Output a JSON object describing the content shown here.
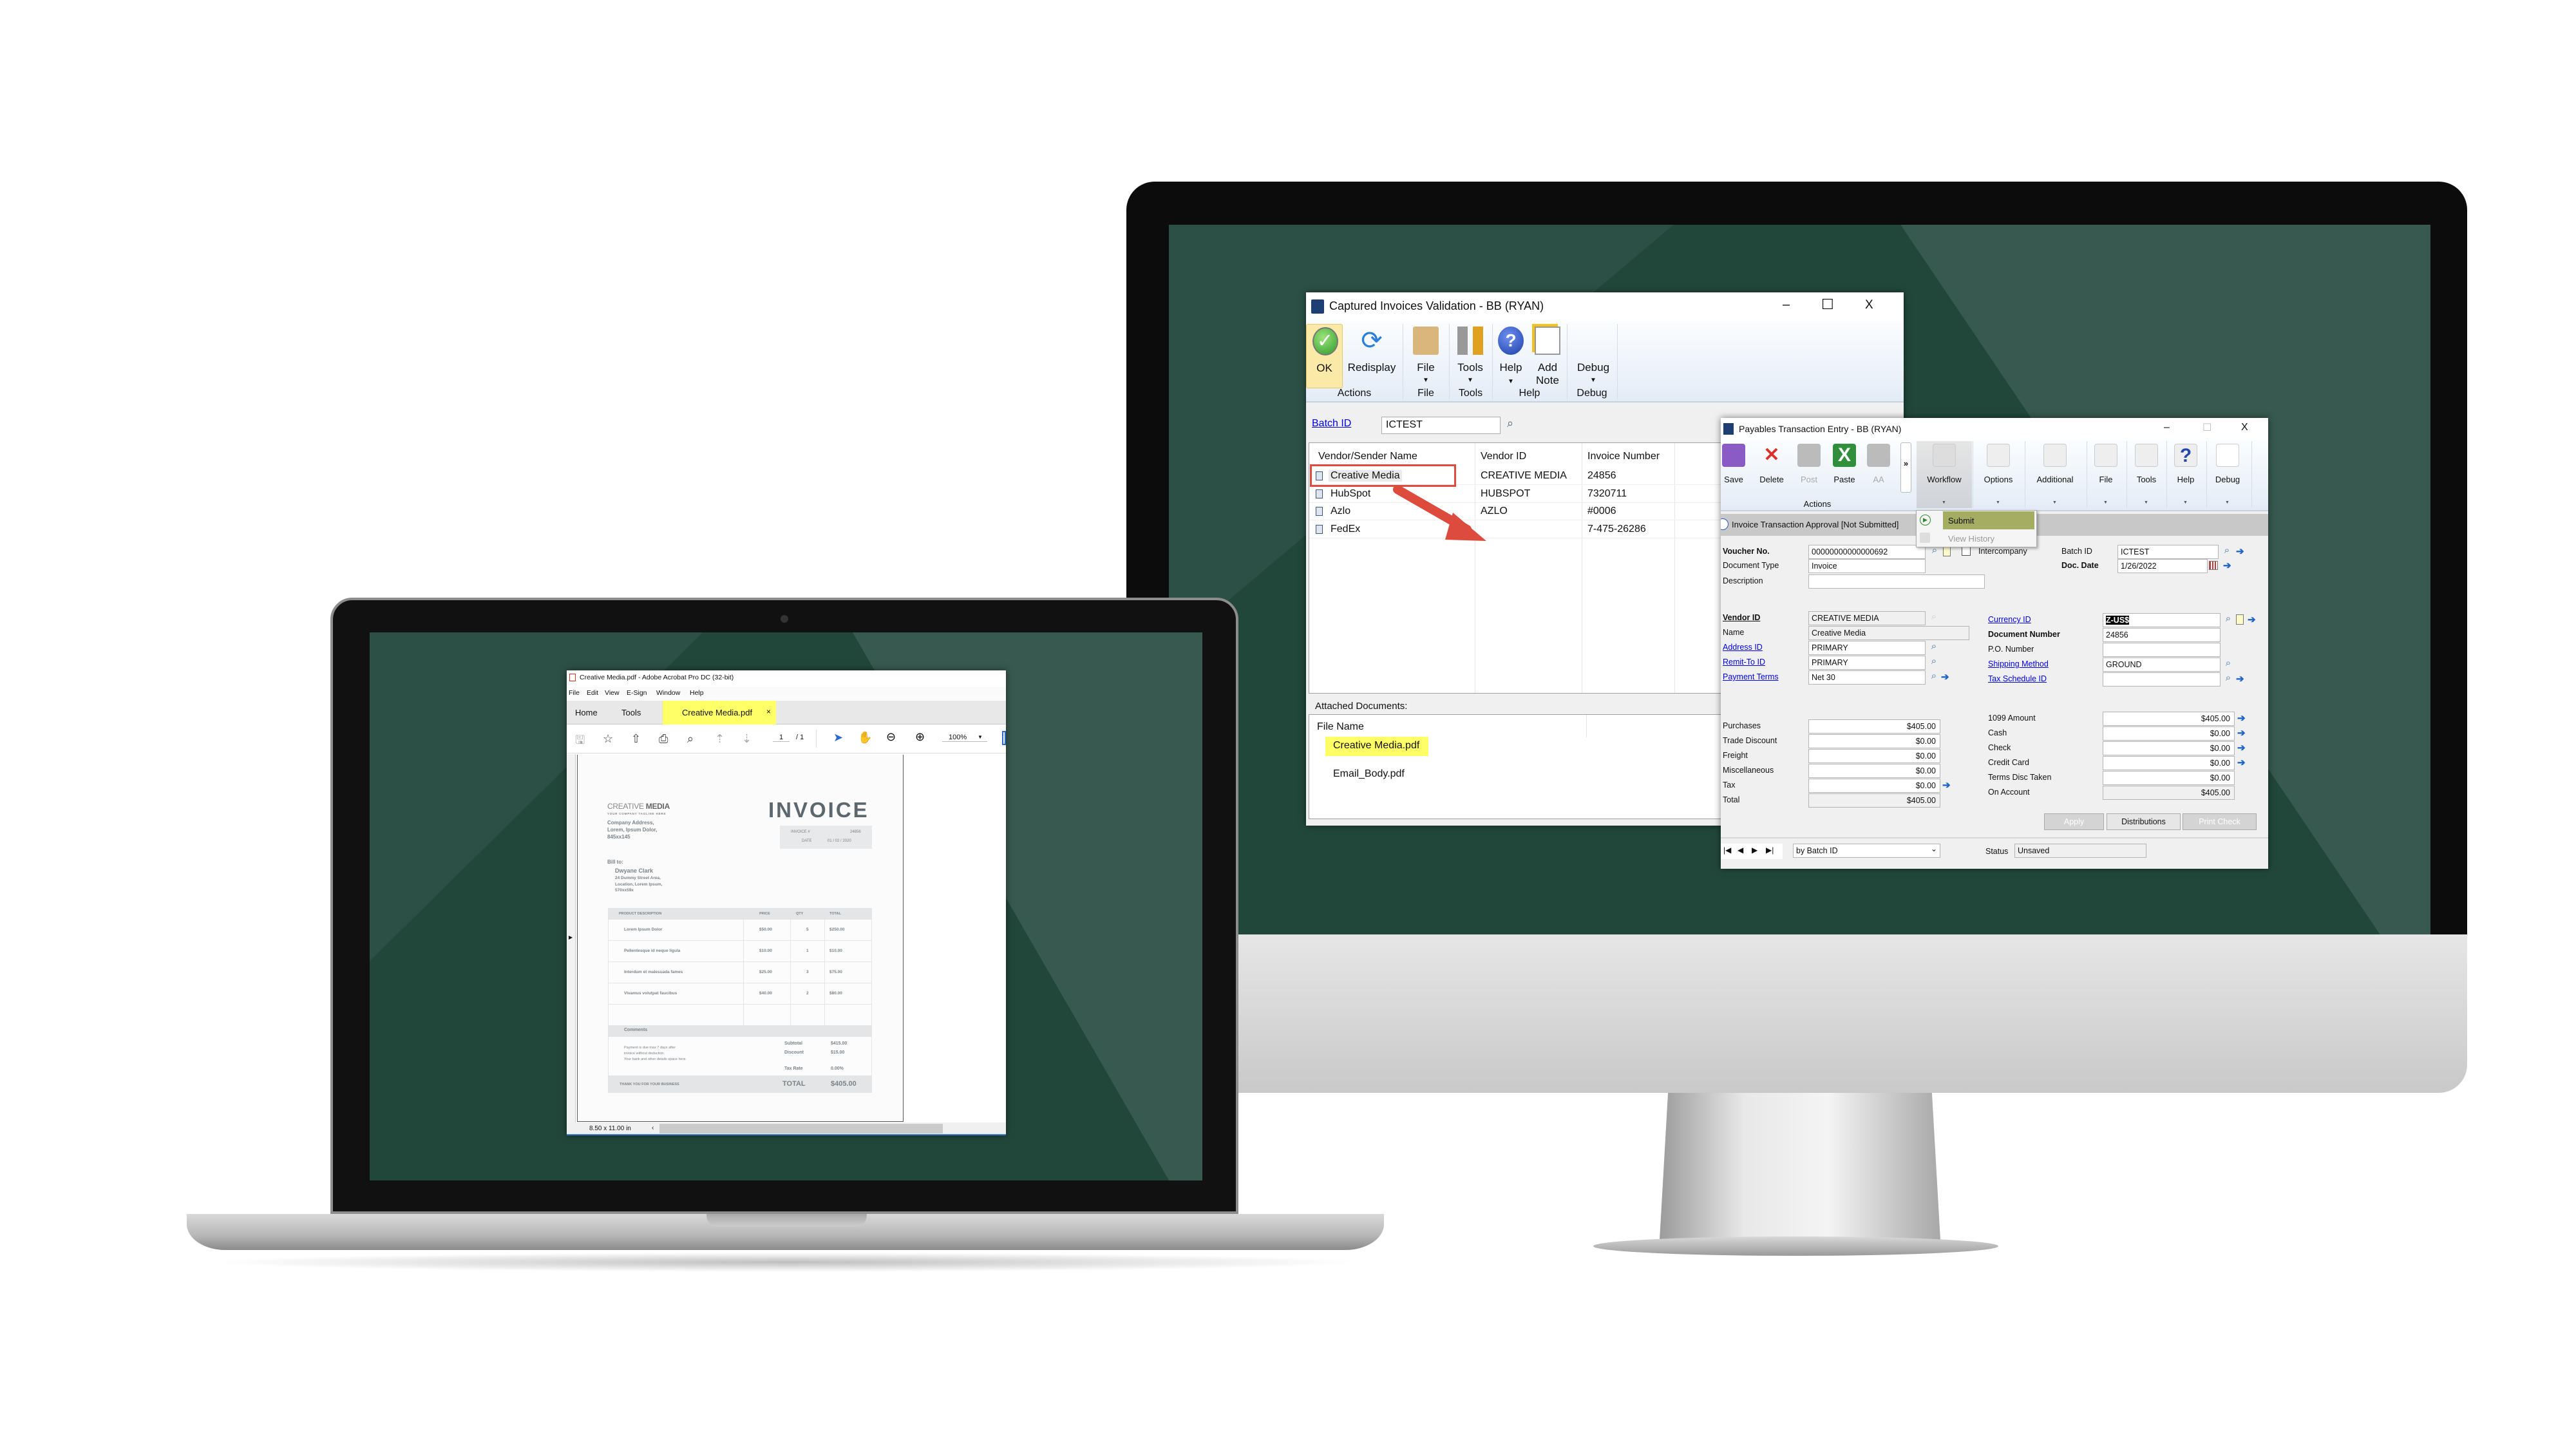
{
  "colors": {
    "wallpaper": "#21473b",
    "highlight_yellow": "#ffff66",
    "submit_highlight": "#a4ad62",
    "red_box": "#e04a3f",
    "link": "#0000ee"
  },
  "captured": {
    "title": "Captured Invoices Validation  -  BB (RYAN)",
    "controls": {
      "minimize": "–",
      "maximize": "☐",
      "close": "X"
    },
    "ribbon": {
      "buttons": [
        {
          "label": "OK",
          "icon": "check-icon"
        },
        {
          "label": "Redisplay",
          "icon": "refresh-icon"
        },
        {
          "label": "File",
          "icon": "folder-icon",
          "dropdown": true
        },
        {
          "label": "Tools",
          "icon": "tools-icon",
          "dropdown": true
        },
        {
          "label": "Help",
          "icon": "help-icon",
          "dropdown": true
        },
        {
          "label": "Add Note",
          "icon": "note-icon"
        },
        {
          "label": "Debug",
          "icon": "none",
          "dropdown": true
        }
      ],
      "groups": [
        "Actions",
        "File",
        "Tools",
        "Help",
        "Debug"
      ]
    },
    "batch_label": "Batch ID",
    "batch_value": "ICTEST",
    "grid": {
      "columns": [
        "Vendor/Sender Name",
        "Vendor ID",
        "Invoice Number"
      ],
      "rows": [
        [
          "Creative Media",
          "CREATIVE MEDIA",
          "24856"
        ],
        [
          "HubSpot",
          "HUBSPOT",
          "7320711"
        ],
        [
          "Azlo",
          "AZLO",
          "#0006"
        ],
        [
          "FedEx",
          "",
          "7-475-26286"
        ]
      ],
      "highlighted_row": 0
    },
    "attached_label": "Attached Documents:",
    "files_header": "File Name",
    "files": [
      "Creative Media.pdf",
      "Email_Body.pdf"
    ],
    "highlighted_file": 0
  },
  "payables": {
    "title": "Payables Transaction Entry  -  BB (RYAN)",
    "controls": {
      "minimize": "–",
      "maximize": "☐",
      "close": "X"
    },
    "ribbon": {
      "buttons": [
        {
          "label": "Save",
          "icon": "save-icon"
        },
        {
          "label": "Delete",
          "icon": "delete-icon"
        },
        {
          "label": "Post",
          "icon": "post-icon",
          "disabled": true
        },
        {
          "label": "Paste",
          "icon": "excel-icon"
        },
        {
          "label": "AA",
          "icon": "hierarchy-icon",
          "disabled": true
        },
        {
          "label": "»",
          "icon": "more-icon"
        },
        {
          "label": "Workflow",
          "icon": "workflow-icon",
          "active": true
        },
        {
          "label": "Options",
          "icon": "options-icon"
        },
        {
          "label": "Additional",
          "icon": "additional-icon"
        },
        {
          "label": "File",
          "icon": "folder-icon"
        },
        {
          "label": "Tools",
          "icon": "tools-icon"
        },
        {
          "label": "Help",
          "icon": "help-icon"
        },
        {
          "label": "Debug",
          "icon": "none"
        }
      ],
      "actions_label": "Actions"
    },
    "approval_text": "Invoice Transaction Approval [Not Submitted]",
    "workflow_menu": [
      {
        "label": "Submit",
        "highlighted": true
      },
      {
        "label": "View History",
        "disabled": true
      }
    ],
    "header_fields": [
      {
        "label": "Voucher No.",
        "value": "00000000000000692",
        "bold": true
      },
      {
        "label": "Document Type",
        "value": "Invoice",
        "select": true
      },
      {
        "label": "Description",
        "value": ""
      }
    ],
    "intercompany_label": "Intercompany",
    "intercompany_checked": false,
    "batch": {
      "label": "Batch ID",
      "value": "ICTEST"
    },
    "doc_date": {
      "label": "Doc. Date",
      "value": "1/26/2022"
    },
    "vendor_fields": [
      {
        "label": "Vendor ID",
        "value": "CREATIVE MEDIA",
        "bold": true
      },
      {
        "label": "Name",
        "value": "Creative Media"
      },
      {
        "label": "Address ID",
        "value": "PRIMARY",
        "link": true
      },
      {
        "label": "Remit-To ID",
        "value": "PRIMARY",
        "link": true
      },
      {
        "label": "Payment Terms",
        "value": "Net 30",
        "link": true
      }
    ],
    "right_fields": [
      {
        "label": "Currency ID",
        "value": "Z-US$",
        "link": true,
        "selected": true
      },
      {
        "label": "Document Number",
        "value": "24856",
        "bold": true
      },
      {
        "label": "P.O. Number",
        "value": ""
      },
      {
        "label": "Shipping Method",
        "value": "GROUND",
        "link": true
      },
      {
        "label": "Tax Schedule ID",
        "value": "",
        "link": true
      }
    ],
    "amounts_left": [
      {
        "label": "Purchases",
        "value": "$405.00"
      },
      {
        "label": "Trade Discount",
        "value": "$0.00"
      },
      {
        "label": "Freight",
        "value": "$0.00"
      },
      {
        "label": "Miscellaneous",
        "value": "$0.00"
      },
      {
        "label": "Tax",
        "value": "$0.00"
      },
      {
        "label": "Total",
        "value": "$405.00"
      }
    ],
    "amounts_right": [
      {
        "label": "1099 Amount",
        "value": "$405.00"
      },
      {
        "label": "Cash",
        "value": "$0.00"
      },
      {
        "label": "Check",
        "value": "$0.00"
      },
      {
        "label": "Credit Card",
        "value": "$0.00"
      },
      {
        "label": "Terms Disc Taken",
        "value": "$0.00"
      },
      {
        "label": "On Account",
        "value": "$405.00"
      }
    ],
    "buttons": [
      {
        "label": "Apply",
        "disabled": true
      },
      {
        "label": "Distributions"
      },
      {
        "label": "Print Check",
        "disabled": true
      }
    ],
    "nav_buttons": [
      "|◀",
      "◀",
      "▶",
      "▶|"
    ],
    "sort_select": "by Batch ID",
    "status_label": "Status",
    "status_value": "Unsaved"
  },
  "acrobat": {
    "title": "Creative Media.pdf - Adobe Acrobat Pro DC (32-bit)",
    "menu": [
      "File",
      "Edit",
      "View",
      "E-Sign",
      "Window",
      "Help"
    ],
    "tabs": [
      {
        "label": "Home"
      },
      {
        "label": "Tools"
      },
      {
        "label": "Creative Media.pdf",
        "active": true
      }
    ],
    "tab_close": "×",
    "toolbar_icons": [
      "save-icon",
      "star-icon",
      "cloud-upload-icon",
      "print-icon",
      "find-icon",
      "page-up-icon",
      "page-down-icon"
    ],
    "page_current": "1",
    "page_total": "/ 1",
    "zoom": "100%",
    "page_size": "8.50 x 11.00 in",
    "invoice": {
      "company": "CREATIVE",
      "company_bold": "MEDIA",
      "tagline": "YOUR COMPANY TAGLINE HERE",
      "address": [
        "Company Address,",
        "Lorem, Ipsum Dolor,",
        "845xx145"
      ],
      "heading": "INVOICE",
      "meta": [
        {
          "label": "INVOICE #",
          "value": "24856"
        },
        {
          "label": "DATE",
          "value": "01 / 02 / 2020"
        }
      ],
      "bill_to_label": "Bill to:",
      "bill_to_name": "Dwyane Clark",
      "bill_to_address": [
        "24 Dummy Street Area,",
        "Location, Lorem Ipsum,",
        "570xx59x"
      ],
      "columns": [
        "PRODUCT DESCRIPTION",
        "PRICE",
        "QTY",
        "TOTAL"
      ],
      "items": [
        [
          "Lorem Ipsum Dolor",
          "$50.00",
          "5",
          "$250.00"
        ],
        [
          "Pellentesque id neque ligula",
          "$10.00",
          "1",
          "$10.00"
        ],
        [
          "Interdum et malesuada fames",
          "$25.00",
          "3",
          "$75.00"
        ],
        [
          "Vivamus volutpat faucibus",
          "$40.00",
          "2",
          "$80.00"
        ]
      ],
      "comments_label": "Comments",
      "comments": [
        "Payment is due max 7 days after",
        "invoice without deduction.",
        "Your bank and other details space here."
      ],
      "summary": [
        {
          "label": "Subtotal",
          "value": "$415.00"
        },
        {
          "label": "Discount",
          "value": "$15.00"
        },
        {
          "label": "Tax Rate",
          "value": "0.00%"
        }
      ],
      "thanks": "THANK YOU FOR YOUR BUSINESS",
      "total_label": "TOTAL",
      "total_value": "$405.00"
    }
  }
}
